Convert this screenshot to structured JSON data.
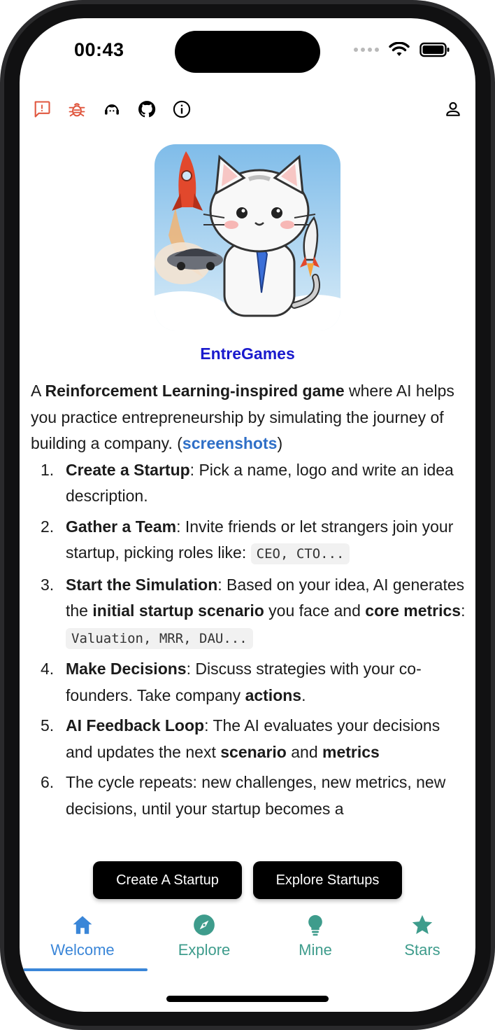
{
  "status": {
    "time": "00:43"
  },
  "app": {
    "name": "EntreGames"
  },
  "intro": {
    "prefix": "A ",
    "bold": "Reinforcement Learning-inspired game",
    "middle": " where AI helps you practice entrepreneurship by simulating the journey of building a company. (",
    "link": "screenshots",
    "suffix": ")"
  },
  "steps": [
    {
      "num": "1.",
      "bold": "Create a Startup",
      "text": ": Pick a name, logo and write an idea description."
    },
    {
      "num": "2.",
      "bold": "Gather a Team",
      "text": ": Invite friends or let strangers join your startup, picking roles like: ",
      "code": "CEO, CTO..."
    },
    {
      "num": "3.",
      "bold": "Start the Simulation",
      "text": ": Based on your idea, AI generates the ",
      "bold2": "initial startup scenario",
      "text2": " you face and ",
      "bold3": "core metrics",
      "text3": ": ",
      "code": "Valuation, MRR, DAU..."
    },
    {
      "num": "4.",
      "bold": "Make Decisions",
      "text": ": Discuss strategies with your co-founders. Take company ",
      "bold2": "actions",
      "text2": "."
    },
    {
      "num": "5.",
      "bold": "AI Feedback Loop",
      "text": ": The AI evaluates your decisions and updates the next ",
      "bold2": "scenario",
      "text2": " and ",
      "bold3": "metrics"
    },
    {
      "num": "6.",
      "text": "The cycle repeats: new challenges, new metrics, new decisions, until your startup becomes a"
    }
  ],
  "buttons": {
    "create": "Create A Startup",
    "explore": "Explore Startups"
  },
  "tabs": [
    {
      "label": "Welcome",
      "icon": "home-icon",
      "active": true
    },
    {
      "label": "Explore",
      "icon": "compass-icon",
      "active": false
    },
    {
      "label": "Mine",
      "icon": "lightbulb-icon",
      "active": false
    },
    {
      "label": "Stars",
      "icon": "star-icon",
      "active": false
    }
  ],
  "colors": {
    "accent": "#3a86d8",
    "tab_inactive": "#3e9c8c",
    "link": "#2f6fc7",
    "title": "#1a1acd",
    "toolbar_red": "#e0573f"
  }
}
